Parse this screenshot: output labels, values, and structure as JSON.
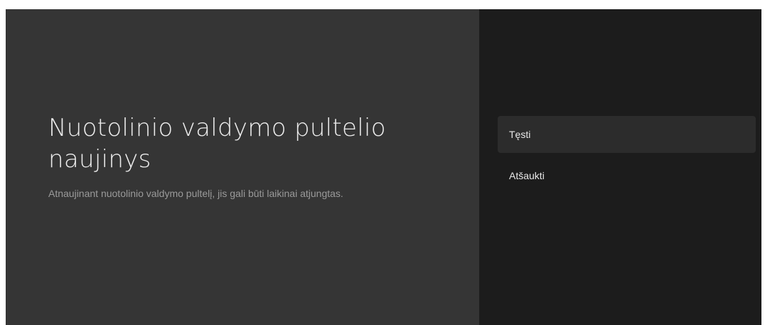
{
  "dialog": {
    "title": "Nuotolinio valdymo pultelio naujinys",
    "description": "Atnaujinant nuotolinio valdymo pultelį, jis gali būti laikinai atjungtas."
  },
  "actions": [
    {
      "label": "Tęsti",
      "focused": true
    },
    {
      "label": "Atšaukti",
      "focused": false
    }
  ],
  "colors": {
    "left_panel": "#353535",
    "right_panel": "#1c1c1c",
    "focused_item": "#2c2c2c"
  }
}
